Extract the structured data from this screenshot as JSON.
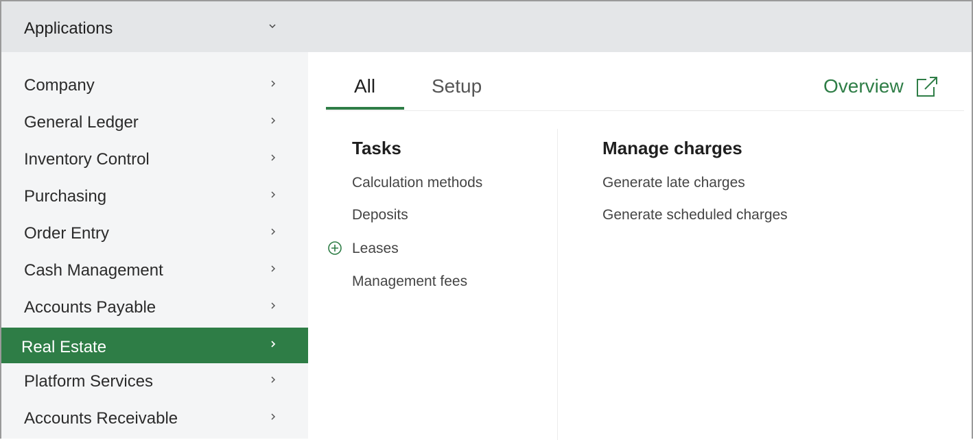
{
  "sidebar": {
    "header": {
      "title": "Applications",
      "toggle_icon": "chevron-down-icon"
    },
    "items": [
      {
        "label": "Company"
      },
      {
        "label": "General Ledger"
      },
      {
        "label": "Inventory Control"
      },
      {
        "label": "Purchasing"
      },
      {
        "label": "Order Entry"
      },
      {
        "label": "Cash Management"
      },
      {
        "label": "Accounts Payable"
      },
      {
        "label": "Real Estate",
        "active": true
      },
      {
        "label": "Platform Services"
      },
      {
        "label": "Accounts Receivable"
      }
    ]
  },
  "tabs": [
    {
      "label": "All",
      "active": true
    },
    {
      "label": "Setup"
    }
  ],
  "overview": {
    "label": "Overview",
    "icon": "external-link-icon"
  },
  "columns": [
    {
      "title": "Tasks",
      "links": [
        {
          "label": "Calculation methods"
        },
        {
          "label": "Deposits"
        },
        {
          "label": "Leases",
          "icon": "plus-circle-icon"
        },
        {
          "label": "Management fees"
        }
      ]
    },
    {
      "title": "Manage charges",
      "links": [
        {
          "label": "Generate late charges"
        },
        {
          "label": "Generate scheduled charges"
        }
      ]
    }
  ],
  "colors": {
    "accent": "#2e7d46",
    "header_bg": "#e4e6e8",
    "sidebar_bg": "#f4f5f6"
  }
}
